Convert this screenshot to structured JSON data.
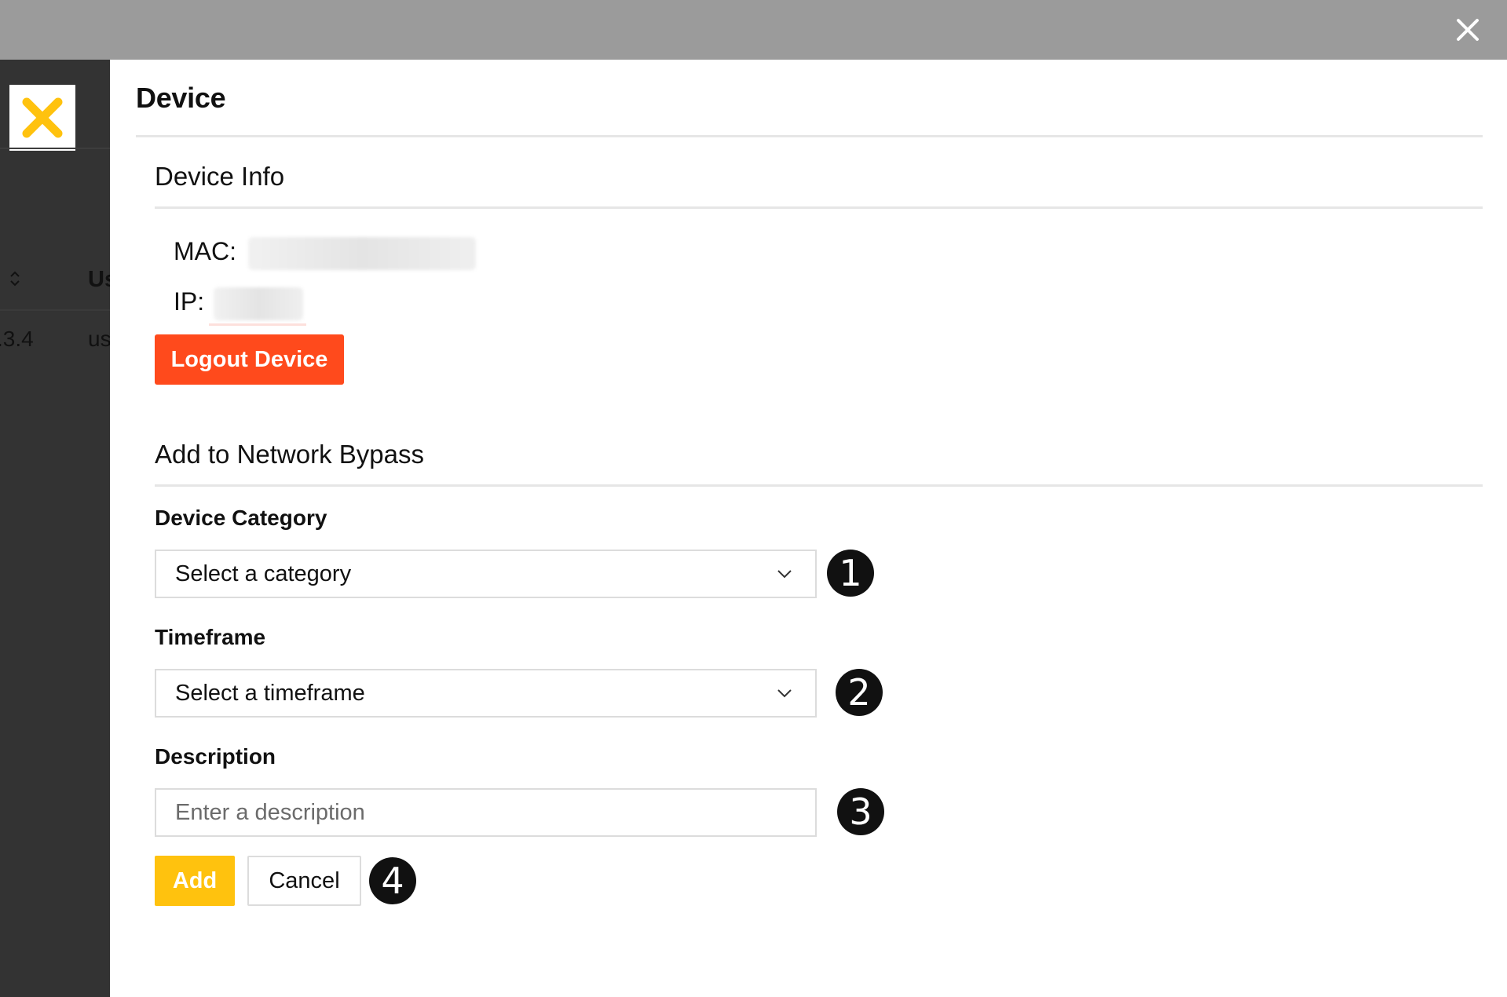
{
  "background": {
    "table_header": "Us",
    "row_ip": ".3.4",
    "row_user": "us"
  },
  "panel": {
    "title": "Device",
    "device_info": {
      "title": "Device Info",
      "mac_label": "MAC:",
      "ip_label": "IP:",
      "logout_label": "Logout Device"
    },
    "bypass": {
      "title": "Add to Network Bypass",
      "category_label": "Device Category",
      "category_value": "Select a category",
      "timeframe_label": "Timeframe",
      "timeframe_value": "Select a timeframe",
      "description_label": "Description",
      "description_placeholder": "Enter a description",
      "add_label": "Add",
      "cancel_label": "Cancel"
    }
  },
  "callouts": [
    "1",
    "2",
    "3",
    "4"
  ],
  "colors": {
    "logout": "#ff4a1c",
    "add": "#ffc20e",
    "logo": "#ffc20e",
    "overlay": "#9b9b9b"
  },
  "icons": [
    "close-icon",
    "logo-x-icon",
    "sort-icon",
    "chevron-down-icon"
  ]
}
